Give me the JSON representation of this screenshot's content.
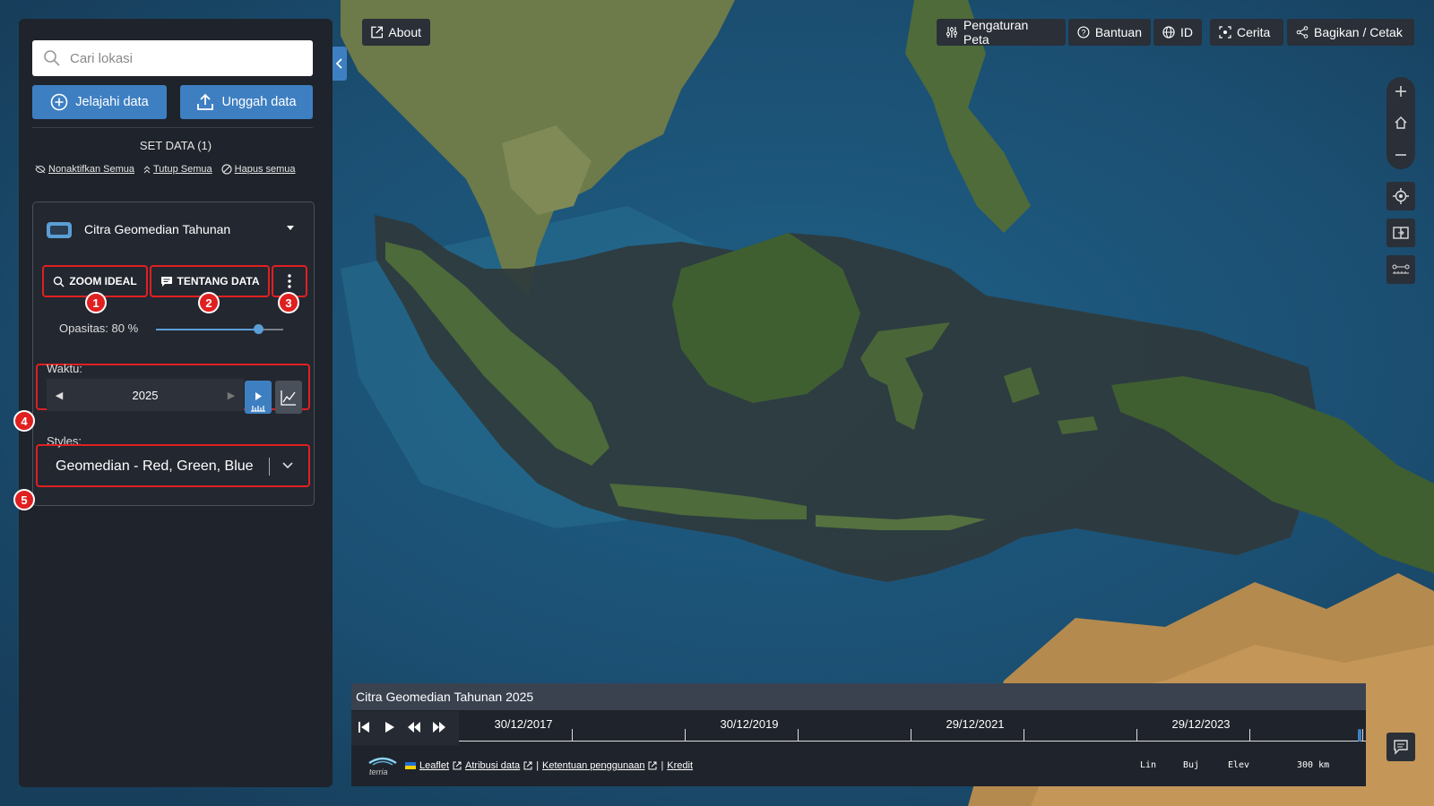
{
  "search": {
    "placeholder": "Cari lokasi"
  },
  "buttons": {
    "explore": "Jelajahi data",
    "upload": "Unggah data"
  },
  "datasets": {
    "title": "SET DATA (1)",
    "disable_all": "Nonaktifkan Semua",
    "collapse_all": "Tutup Semua",
    "remove_all": "Hapus semua"
  },
  "layer": {
    "name": "Citra Geomedian Tahunan",
    "zoom_ideal": "ZOOM IDEAL",
    "about_data": "TENTANG DATA",
    "opacity_label": "Opasitas: 80 %",
    "opacity_value": 0.8,
    "time_label": "Waktu:",
    "year": "2025",
    "styles_label": "Styles:",
    "style_value": "Geomedian - Red, Green, Blue"
  },
  "badges": [
    "1",
    "2",
    "3",
    "4",
    "5"
  ],
  "topbar": {
    "about": "About",
    "map_settings": "Pengaturan Peta",
    "help": "Bantuan",
    "lang": "ID",
    "story": "Cerita",
    "share": "Bagikan / Cetak"
  },
  "timeline": {
    "title": "Citra Geomedian Tahunan 2025",
    "dates": [
      "30/12/2017",
      "30/12/2019",
      "29/12/2021",
      "29/12/2023"
    ]
  },
  "credits": {
    "leaflet": "Leaflet",
    "attribution": "Atribusi data",
    "terms": "Ketentuan penggunaan",
    "credit": "Kredit",
    "sep": "|",
    "logo_text": "terria"
  },
  "coords": {
    "lat": "Lin",
    "lon": "Buj",
    "elev": "Elev",
    "scale": "300 km"
  },
  "colors": {
    "accent": "#3e7fc2",
    "panel": "#1f232b",
    "highlight": "#e02020",
    "ocean": "#1e4f6e"
  }
}
